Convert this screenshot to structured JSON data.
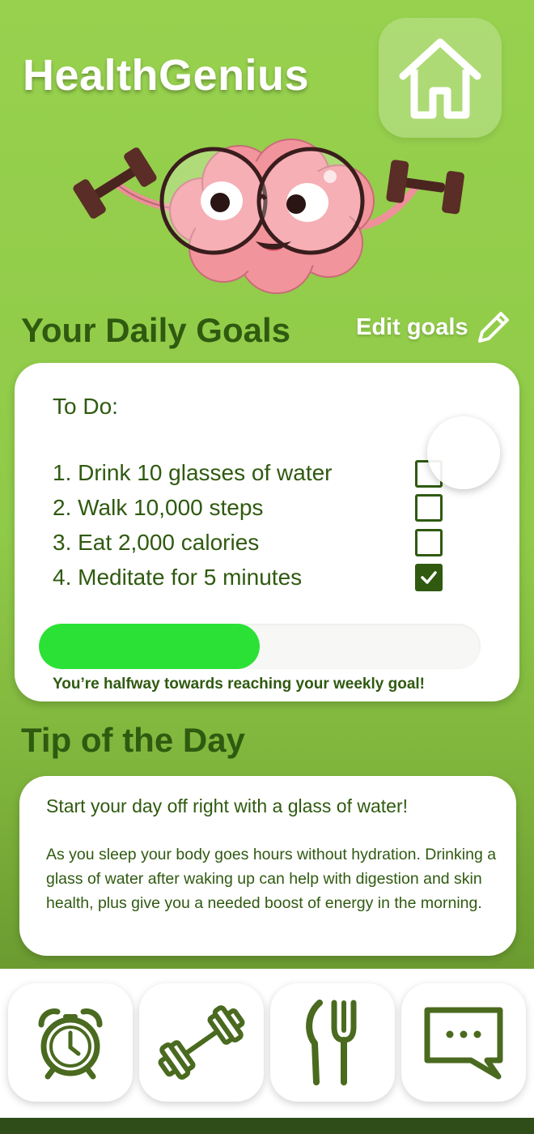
{
  "app": {
    "title": "HealthGenius"
  },
  "goals": {
    "section_title": "Your Daily Goals",
    "edit_label": "Edit goals",
    "todo_heading": "To Do:",
    "items": [
      {
        "label": "1. Drink 10 glasses of water",
        "checked": false
      },
      {
        "label": "2. Walk 10,000 steps",
        "checked": false
      },
      {
        "label": "3. Eat 2,000 calories",
        "checked": false
      },
      {
        "label": "4. Meditate for 5 minutes",
        "checked": true
      }
    ],
    "progress": 0.5,
    "progress_caption": "You’re halfway towards reaching your weekly goal!"
  },
  "tip": {
    "section_title": "Tip of the Day",
    "heading": "Start your day off right with a glass of water!",
    "body": "As you sleep your body goes hours without hydration. Drinking a glass of water after waking up can help with digestion and skin health, plus give you a needed boost of energy in the morning."
  },
  "nav": {
    "items": [
      {
        "icon": "alarm-clock-icon"
      },
      {
        "icon": "dumbbell-icon"
      },
      {
        "icon": "fork-knife-icon"
      },
      {
        "icon": "chat-bubble-icon"
      }
    ]
  },
  "colors": {
    "brand_green": "#97d14e",
    "dark_green": "#2f5a10",
    "progress_green": "#2be135"
  }
}
